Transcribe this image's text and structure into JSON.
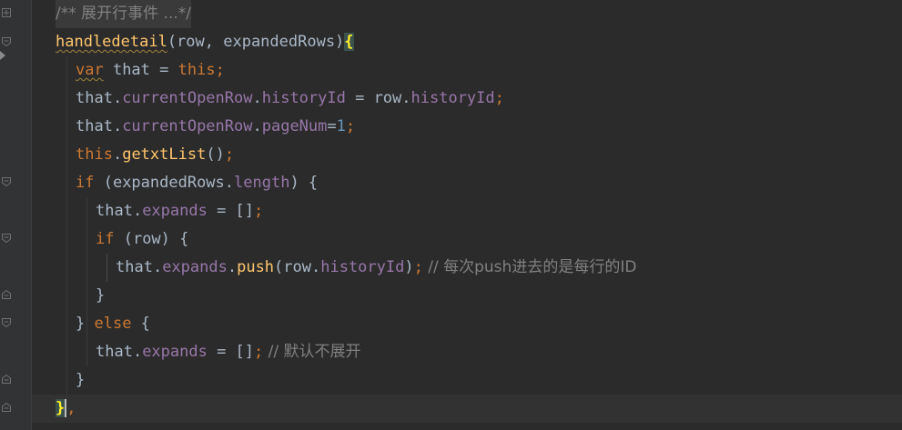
{
  "editor": {
    "theme_colors": {
      "background": "#2b2b2b",
      "keyword": "#cc7832",
      "function": "#ffc66d",
      "property": "#9876aa",
      "number": "#6897bb",
      "comment": "#808080",
      "text": "#a9b7c6"
    },
    "lines": [
      {
        "comment": "/** 展开行事件 ...*/"
      },
      {
        "fn_name": "handledetail",
        "params_open": "(row, expandedRows)",
        "brace": "{"
      },
      {
        "kw_var": "var",
        "rest": " that = ",
        "kw_this": "this",
        "semi": ";"
      },
      {
        "obj": "that.",
        "p1": "currentOpenRow",
        "dot": ".",
        "p2": "historyId",
        "eq": " = row.",
        "p3": "historyId",
        "semi": ";"
      },
      {
        "obj": "that.",
        "p1": "currentOpenRow",
        "dot": ".",
        "p2": "pageNum",
        "eq": "=",
        "num": "1",
        "semi": ";"
      },
      {
        "kw_this": "this",
        "dot": ".",
        "fn": "getxtList",
        "rest": "()",
        "semi": ";"
      },
      {
        "kw_if": "if",
        "rest1": " (expandedRows.",
        "p1": "length",
        "rest2": ") {"
      },
      {
        "obj": "that.",
        "p1": "expands",
        "rest": " = []",
        "semi": ";"
      },
      {
        "kw_if": "if",
        "rest": " (row) {"
      },
      {
        "obj": "that.",
        "p1": "expands",
        "dot": ".",
        "fn": "push",
        "rest1": "(row.",
        "p2": "historyId",
        "rest2": ")",
        "semi": ";",
        "comment": " // 每次push进去的是每行的ID"
      },
      {
        "brace": "}"
      },
      {
        "brace": "} ",
        "kw_else": "else",
        "rest": " {"
      },
      {
        "obj": "that.",
        "p1": "expands",
        "rest": " = []",
        "semi": ";",
        "comment": " // 默认不展开"
      },
      {
        "brace": "}"
      },
      {
        "brace": "}",
        "comma": ","
      }
    ]
  }
}
